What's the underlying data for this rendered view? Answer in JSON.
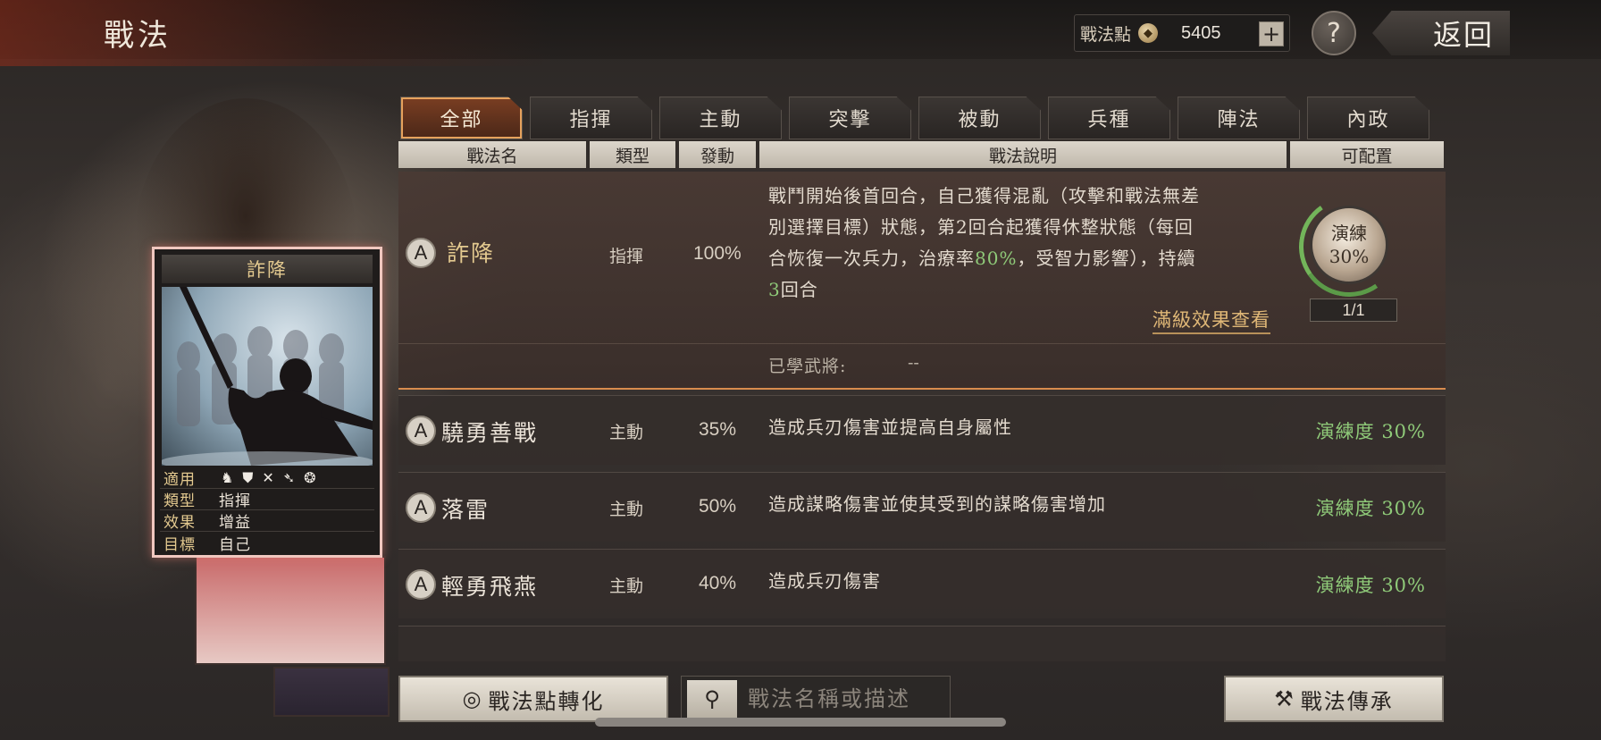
{
  "header": {
    "title": "戰法",
    "points_label": "戰法點",
    "points_value": "5405",
    "add_symbol": "+",
    "help_symbol": "?",
    "back_label": "返回"
  },
  "tabs": [
    {
      "label": "全部",
      "active": true
    },
    {
      "label": "指揮"
    },
    {
      "label": "主動"
    },
    {
      "label": "突擊"
    },
    {
      "label": "被動"
    },
    {
      "label": "兵種"
    },
    {
      "label": "陣法"
    },
    {
      "label": "內政"
    }
  ],
  "columns": [
    "戰法名",
    "類型",
    "發動",
    "戰法說明",
    "可配置"
  ],
  "expanded": {
    "grade": "A",
    "name": "詐降",
    "type": "指揮",
    "rate": "100%",
    "desc_line1": "戰鬥開始後首回合，自己獲得混亂（攻擊和戰法無差",
    "desc_line2": "別選擇目標）狀態，第2回合起獲得休整狀態（每回",
    "desc_line3a": "合恢復一次兵力，治療率",
    "desc_line3b": "80%",
    "desc_line3c": "，受智力影響），持續",
    "desc_line4a": "3",
    "desc_line4b": "回合",
    "full_effect_link": "滿級效果查看",
    "learned_label": "已學武將:",
    "learned_value": "--",
    "medal_label": "演練",
    "medal_percent": "30%",
    "medal_progress": 0.3,
    "config_count": "1/1"
  },
  "rows": [
    {
      "grade": "A",
      "name": "驍勇善戰",
      "type": "主動",
      "rate": "35%",
      "desc": "造成兵刃傷害並提高自身屬性",
      "progress": "演練度 30%"
    },
    {
      "grade": "A",
      "name": "落雷",
      "type": "主動",
      "rate": "50%",
      "desc": "造成謀略傷害並使其受到的謀略傷害增加",
      "progress": "演練度 30%"
    },
    {
      "grade": "A",
      "name": "輕勇飛燕",
      "type": "主動",
      "rate": "40%",
      "desc": "造成兵刃傷害",
      "progress": "演練度 30%"
    }
  ],
  "card": {
    "title": "詐降",
    "applicable_label": "適用",
    "type_label": "類型",
    "type_value": "指揮",
    "effect_label": "效果",
    "effect_value": "增益",
    "target_label": "目標",
    "target_value": "自己",
    "unit_icons": [
      "cavalry-icon",
      "shield-icon",
      "bow-icon",
      "spear-icon",
      "wheel-icon"
    ]
  },
  "bottom": {
    "convert_label": "戰法點轉化",
    "search_placeholder": "戰法名稱或描述",
    "inherit_label": "戰法傳承"
  },
  "colors": {
    "accent_orange": "#e6a25d",
    "progress_green": "#8fca79",
    "gold_text": "#e3c98f"
  }
}
